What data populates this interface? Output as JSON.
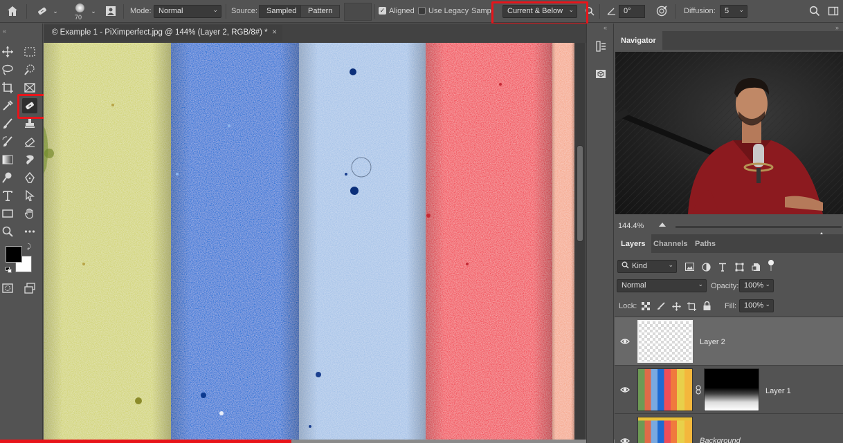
{
  "options_bar": {
    "brush_size": "70",
    "mode_label": "Mode:",
    "mode_value": "Normal",
    "source_label": "Source:",
    "source_sampled": "Sampled",
    "source_pattern": "Pattern",
    "aligned_label": "Aligned",
    "aligned_checked": true,
    "use_legacy_label": "Use Legacy",
    "use_legacy_checked": false,
    "sample_label": "Sampl",
    "sample_value": "Current & Below",
    "angle_value": "0°",
    "diffusion_label": "Diffusion:",
    "diffusion_value": "5"
  },
  "document": {
    "tab_title": "© Example 1 - PiXimperfect.jpg @ 144% (Layer 2, RGB/8#) *",
    "close_glyph": "×",
    "stripe_colors": [
      "#d2d475",
      "#1c6fd6",
      "#a6c3e8",
      "#f24a55",
      "#f6a98e"
    ]
  },
  "toolbar": {
    "foreground_color": "#000000",
    "background_color": "#ffffff"
  },
  "navigator": {
    "tab": "Navigator",
    "zoom": "144.4%",
    "zoom_slider_position": 0.88
  },
  "layers_panel": {
    "tabs": [
      "Layers",
      "Channels",
      "Paths"
    ],
    "filter_kind": "Kind",
    "blend_mode": "Normal",
    "opacity_label": "Opacity:",
    "opacity_value": "100%",
    "lock_label": "Lock:",
    "fill_label": "Fill:",
    "fill_value": "100%",
    "layers": [
      {
        "name": "Layer 2",
        "selected": true
      },
      {
        "name": "Layer 1",
        "selected": false
      },
      {
        "name": "Background",
        "selected": false
      }
    ]
  },
  "video_progress": 0.346
}
